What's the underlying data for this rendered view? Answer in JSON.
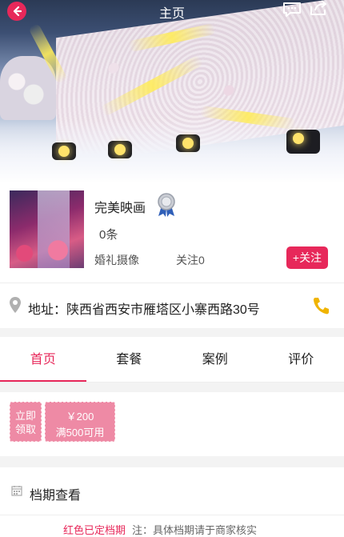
{
  "nav": {
    "title": "主页"
  },
  "store": {
    "name": "完美映画",
    "count": "0条",
    "tag": "婚礼摄像",
    "follow_count": "关注0",
    "follow_label": "+关注"
  },
  "address": {
    "text": "地址：陕西省西安市雁塔区小寨西路30号"
  },
  "tabs": [
    {
      "label": "首页"
    },
    {
      "label": "套餐"
    },
    {
      "label": "案例"
    },
    {
      "label": "评价"
    }
  ],
  "coupon": {
    "claim_label_1": "立即",
    "claim_label_2": "领取",
    "amount": "￥200",
    "condition": "满500可用"
  },
  "schedule": {
    "label": "档期查看"
  },
  "note": {
    "highlight": "红色已定档期",
    "text": "注：具体档期请于商家核实"
  },
  "colors": {
    "accent": "#e7285a",
    "coupon": "#ee8aa5",
    "phone": "#f0b400"
  },
  "icons": {
    "back": "back-arrow-icon",
    "message": "message-icon",
    "share": "share-icon",
    "badge": "verified-medal-icon",
    "location": "location-pin-icon",
    "phone": "phone-icon",
    "calendar": "calendar-icon"
  }
}
